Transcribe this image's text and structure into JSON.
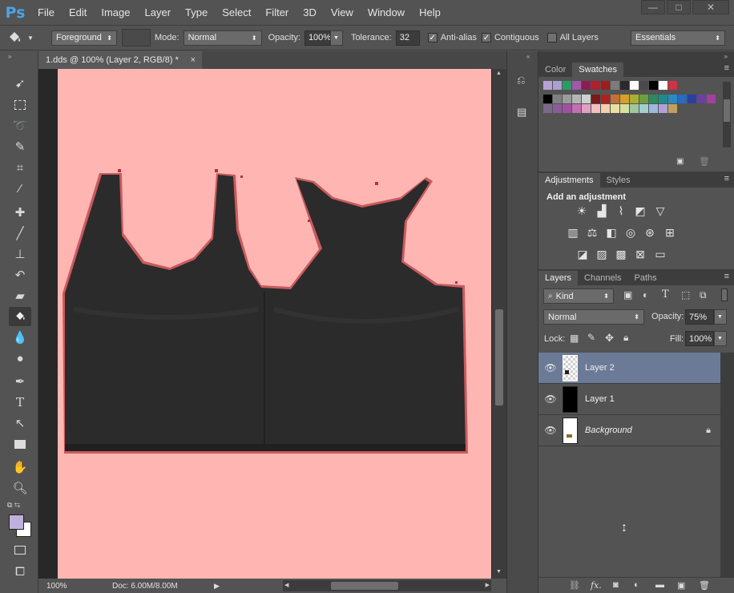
{
  "app": {
    "logo": "Ps"
  },
  "menu": [
    "File",
    "Edit",
    "Image",
    "Layer",
    "Type",
    "Select",
    "Filter",
    "3D",
    "View",
    "Window",
    "Help"
  ],
  "window_controls": {
    "minimize": "—",
    "maximize": "□",
    "close": "✕"
  },
  "options": {
    "fill_source": "Foreground",
    "mode_label": "Mode:",
    "mode_value": "Normal",
    "opacity_label": "Opacity:",
    "opacity_value": "100%",
    "tolerance_label": "Tolerance:",
    "tolerance_value": "32",
    "antialias_label": "Anti-alias",
    "contiguous_label": "Contiguous",
    "all_layers_label": "All Layers",
    "workspace": "Essentials"
  },
  "document": {
    "tab_title": "1.dds @ 100% (Layer 2, RGB/8) *",
    "close": "×",
    "zoom": "100%",
    "doc_info": "Doc: 6.00M/8.00M",
    "canvas_color": "#ffb6b2",
    "garment_color": "#2b2b2b"
  },
  "color_panel": {
    "tabs": [
      "Color",
      "Swatches"
    ],
    "active_tab": "Swatches",
    "row1": [
      "#b7a2d6",
      "#a9a0cf",
      "#2b9a64",
      "#9c5aa8",
      "#8a1f4f",
      "#b01f2a",
      "#9c1e1e",
      "#7c7c7c",
      "#2a2a2a",
      "#ffffff",
      "#4a4a4a",
      "#000000",
      "#ffffff",
      "#cc3344"
    ],
    "row2": [
      "#000000",
      "#7f7f7f",
      "#9b9b9b",
      "#b4b4b4",
      "#cfcfcf",
      "#7a1a1a",
      "#b02020",
      "#c0703a",
      "#d6a02a",
      "#a8b030",
      "#6aa040",
      "#2a8a60",
      "#208a8a",
      "#2a8ac0",
      "#2a6ac0",
      "#2a40a0",
      "#6a40a0",
      "#a040a0"
    ],
    "row3": [
      "#7a6a8a",
      "#8a5a9a",
      "#a050a0",
      "#c070b0",
      "#e0a0c0",
      "#f0c0c0",
      "#f0d0b0",
      "#e8e0a0",
      "#d8e0a0",
      "#a0c8a0",
      "#a0d0d0",
      "#a0b8e0",
      "#b0a0d8",
      "#c0a060"
    ]
  },
  "adjustments_panel": {
    "tabs": [
      "Adjustments",
      "Styles"
    ],
    "active_tab": "Adjustments",
    "heading": "Add an adjustment"
  },
  "layers_panel": {
    "tabs": [
      "Layers",
      "Channels",
      "Paths"
    ],
    "active_tab": "Layers",
    "filter_kind": "Kind",
    "blend_mode": "Normal",
    "opacity_label": "Opacity:",
    "opacity_value": "75%",
    "lock_label": "Lock:",
    "fill_label": "Fill:",
    "fill_value": "100%",
    "layers": [
      {
        "name": "Layer 2",
        "selected": true
      },
      {
        "name": "Layer 1",
        "selected": false
      },
      {
        "name": "Background",
        "selected": false,
        "locked": true
      }
    ],
    "footer_fx": "fx."
  }
}
